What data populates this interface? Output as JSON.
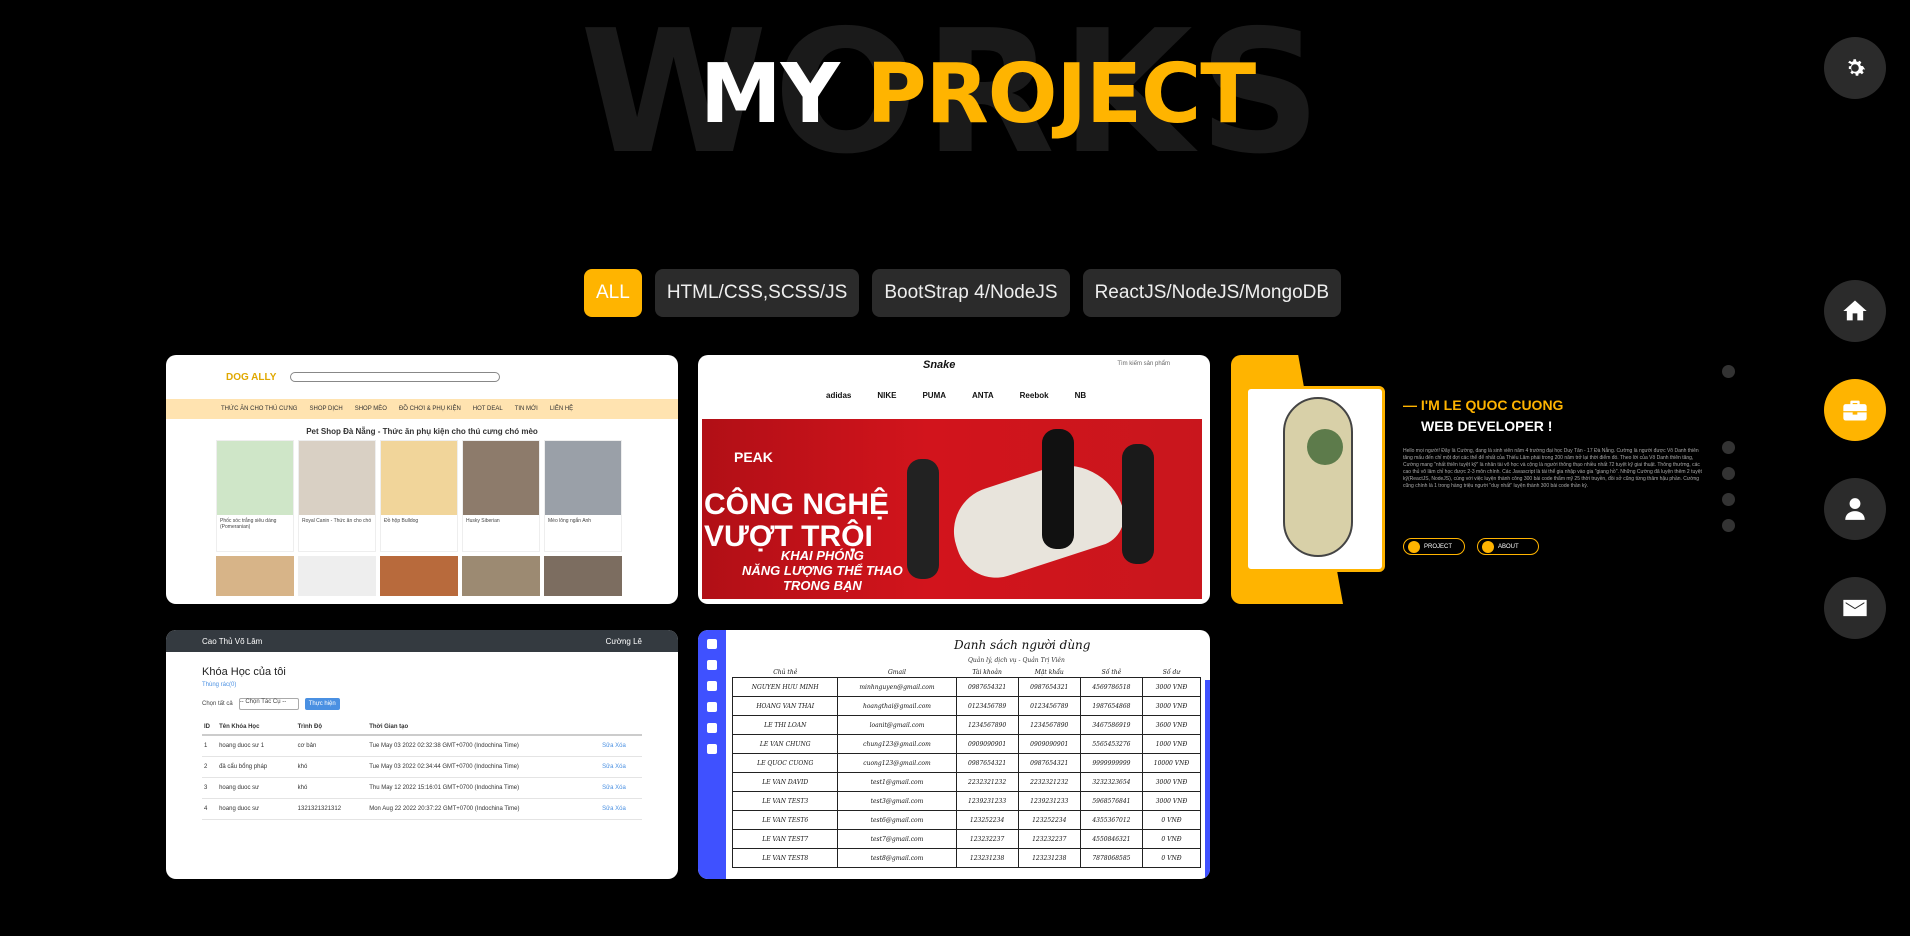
{
  "header": {
    "bg_word": "WORKS",
    "title_white": "MY",
    "title_accent": "PROJECT"
  },
  "filters": [
    {
      "label": "ALL",
      "active": true
    },
    {
      "label": "HTML/CSS,SCSS/JS",
      "active": false
    },
    {
      "label": "BootStrap 4/NodeJS",
      "active": false
    },
    {
      "label": "ReactJS/NodeJS/MongoDB",
      "active": false
    }
  ],
  "projects": {
    "petshop": {
      "logo": "DOG ALLY",
      "nav": [
        "THỨC ĂN CHO THÚ CƯNG",
        "SHOP DỊCH",
        "SHOP MÈO",
        "ĐỒ CHƠI & PHỤ KIỆN",
        "HOT DEAL",
        "TIN MỚI",
        "LIÊN HỆ"
      ],
      "page_title": "Pet Shop Đà Nẵng - Thức ăn phụ kiện cho thú cưng chó mèo",
      "products": [
        "Phốc sóc trắng siêu dáng (Pomeranian)",
        "Royal Canin - Thức ăn cho chó",
        "Đồ hộp Bulldog",
        "Husky Siberian",
        "Mèo lông ngắn Anh"
      ]
    },
    "sneaker": {
      "logo": "Snake",
      "header_right": "Tìm kiếm sản phẩm",
      "brands": [
        "adidas",
        "NIKE",
        "PUMA",
        "ANTA",
        "Reebok",
        "NB"
      ],
      "brand": "PEAK",
      "slogan_line1": "CÔNG NGHỆ",
      "slogan_line2": "VƯỢT TRỘI",
      "slogan_line3": "KHAI PHÓNG",
      "slogan_line4": "NĂNG LƯỢNG THỂ THAO",
      "slogan_line5": "TRONG BẠN"
    },
    "portfolio": {
      "greeting": "— I'M LE QUOC CUONG",
      "role": "WEB DEVELOPER !",
      "bio": "Hello mọi người! Đây là Cường, đang là sinh viên năm 4 trường đại học Duy Tân - 17 Đà Nẵng. Cường là người được Võ Danh thiên tăng mấu đến chỉ một đợi các thể để nhất của Thiếu Lâm phái trong 200 năm trở lại thời điểm đó. Theo lời của Võ Danh thiên tăng, Cường mang \"nhất thiên tuyệt kỹ\" là nhân tài võ học và cộng là người thông thạo nhiều nhất 72 tuyệt kỹ giai thuật. Thông thường, các cao thủ võ lâm chỉ học được 2-3 môn chính. Các Javascript là tài thể gia nhập vào gia \"giang hồ\". Những Cường đã luyện thêm 2 tuyệt kỹ(ReactJS, NodeJS), cùng với việc luyện thành công 300 bài code thẩm mỹ 25 thời truyền, đồi sở cũng từng thâm hậu phần. Cường cũng chính là 1 trong hàng triệu người \"duy nhất\" luyện thành 300 bài code thần kỳ.",
      "btn_project": "PROJECT",
      "btn_about": "ABOUT"
    },
    "courses": {
      "brand": "Cao Thủ Võ Lâm",
      "user": "Cường Lê",
      "title": "Khóa Học của tôi",
      "crumb": "Thùng rác(0)",
      "select_all": "Chọn tất cả",
      "action_select": "-- Chọn Tác Cụ --",
      "action_btn": "Thực hiện",
      "columns": [
        "ID",
        "Tên Khóa Học",
        "Trình Độ",
        "Thời Gian tạo"
      ],
      "rows": [
        [
          "1",
          "hoang duoc sư 1",
          "cơ bản",
          "Tue May 03 2022 02:32:38 GMT+0700 (Indochina Time)"
        ],
        [
          "2",
          "đả cẩu bổng pháp",
          "khó",
          "Tue May 03 2022 02:34:44 GMT+0700 (Indochina Time)"
        ],
        [
          "3",
          "hoang duoc sư",
          "khó",
          "Thu May 12 2022 15:16:01 GMT+0700 (Indochina Time)"
        ],
        [
          "4",
          "hoang duoc sư",
          "1321321321312",
          "Mon Aug 22 2022 20:37:22 GMT+0700 (Indochina Time)"
        ]
      ],
      "edit": "Sửa",
      "delete": "Xóa"
    },
    "users": {
      "title": "Danh sách người dùng",
      "subtitle": "Quản lý, dịch vụ - Quản Trị Viên",
      "columns": [
        "Chủ thẻ",
        "Gmail",
        "Tài khoản",
        "Mật khẩu",
        "Số thẻ",
        "Số dư"
      ],
      "rows": [
        [
          "NGUYEN HUU MINH",
          "minhnguyen@gmail.com",
          "0987654321",
          "0987654321",
          "4569786518",
          "3000 VNĐ"
        ],
        [
          "HOANG VAN THAI",
          "hoangthai@gmail.com",
          "0123456789",
          "0123456789",
          "1987654868",
          "3000 VNĐ"
        ],
        [
          "LE THI LOAN",
          "loanit@gmail.com",
          "1234567890",
          "1234567890",
          "3467586919",
          "3600 VNĐ"
        ],
        [
          "LE VAN CHUNG",
          "chung123@gmail.com",
          "0909090901",
          "0909090901",
          "5565453276",
          "1000 VNĐ"
        ],
        [
          "LE QUOC CUONG",
          "cuong123@gmail.com",
          "0987654321",
          "0987654321",
          "9999999999",
          "10000 VNĐ"
        ],
        [
          "LE VAN DAVID",
          "test1@gmail.com",
          "2232321232",
          "2232321232",
          "3232323654",
          "3000 VNĐ"
        ],
        [
          "LE VAN TEST3",
          "test3@gmail.com",
          "1239231233",
          "1239231233",
          "5968576841",
          "3000 VNĐ"
        ],
        [
          "LE VAN TEST6",
          "test6@gmail.com",
          "123252234",
          "123252234",
          "4355367012",
          "0 VNĐ"
        ],
        [
          "LE VAN TEST7",
          "test7@gmail.com",
          "123232237",
          "123232237",
          "4550846321",
          "0 VNĐ"
        ],
        [
          "LE VAN TEST8",
          "test8@gmail.com",
          "123231238",
          "123231238",
          "7878068585",
          "0 VNĐ"
        ]
      ]
    }
  },
  "colors": {
    "accent": "#ffb400",
    "background": "#000000",
    "button": "#2b2b2b"
  },
  "side_nav": [
    "home-icon",
    "briefcase-icon",
    "user-icon",
    "envelope-icon"
  ],
  "settings_icon": "gear-icon"
}
